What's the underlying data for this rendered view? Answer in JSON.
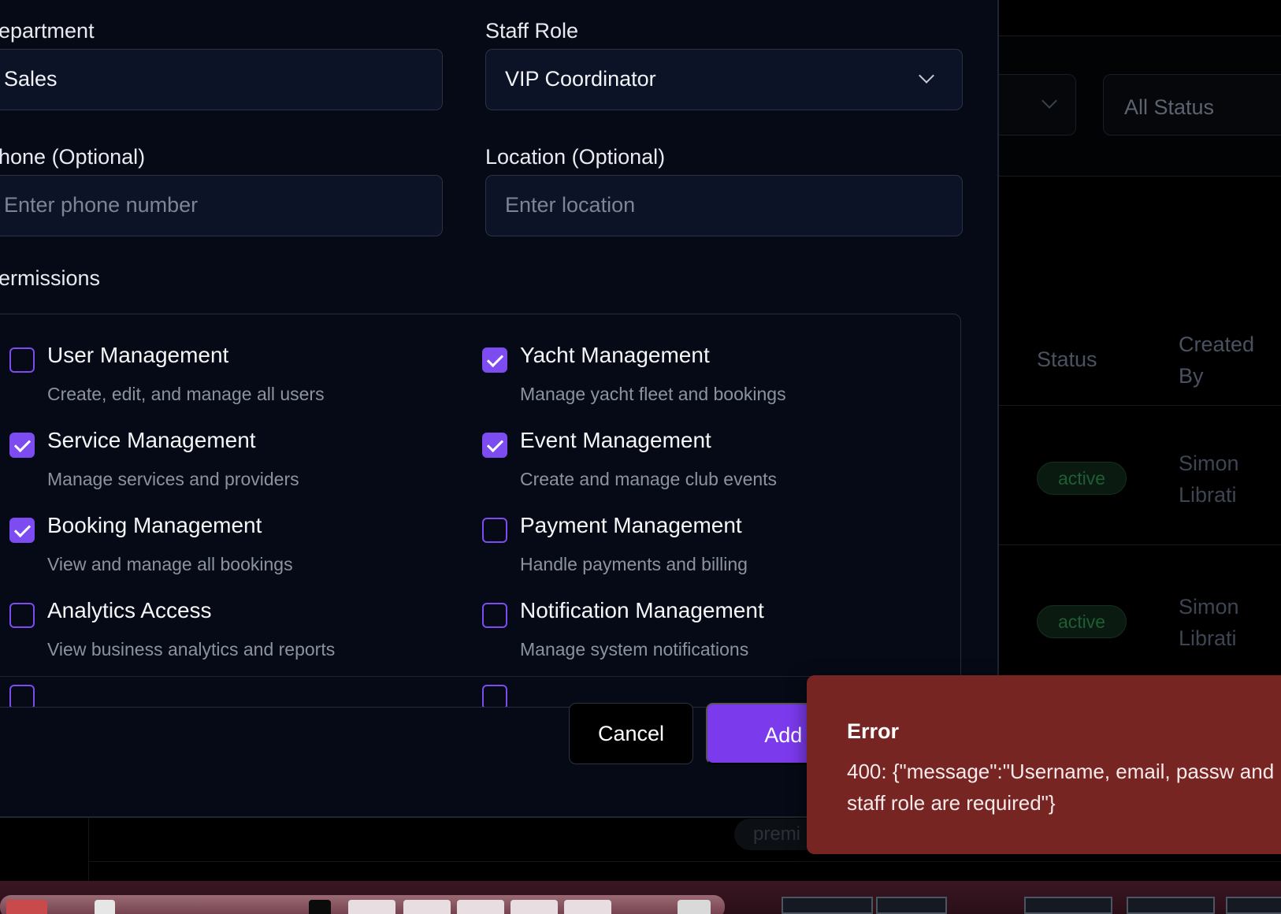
{
  "background": {
    "status_filter": "All Status",
    "table_headers": {
      "status": "Status",
      "created_by": "Created By"
    },
    "rows": [
      {
        "status": "active",
        "created_by": "Simon Librati"
      },
      {
        "status": "active",
        "created_by": "Simon Librati"
      }
    ],
    "partial_badge": "premi"
  },
  "form": {
    "department": {
      "label": "epartment",
      "value": "Sales"
    },
    "staff_role": {
      "label": "Staff Role",
      "value": "VIP Coordinator"
    },
    "phone": {
      "label": "hone (Optional)",
      "placeholder": "Enter phone number"
    },
    "location": {
      "label": "Location (Optional)",
      "placeholder": "Enter location"
    },
    "permissions_heading": "ermissions",
    "permissions": [
      {
        "title": "User Management",
        "desc": "Create, edit, and manage all users",
        "checked": false
      },
      {
        "title": "Yacht Management",
        "desc": "Manage yacht fleet and bookings",
        "checked": true
      },
      {
        "title": "Service Management",
        "desc": "Manage services and providers",
        "checked": true
      },
      {
        "title": "Event Management",
        "desc": "Create and manage club events",
        "checked": true
      },
      {
        "title": "Booking Management",
        "desc": "View and manage all bookings",
        "checked": true
      },
      {
        "title": "Payment Management",
        "desc": "Handle payments and billing",
        "checked": false
      },
      {
        "title": "Analytics Access",
        "desc": "View business analytics and reports",
        "checked": false
      },
      {
        "title": "Notification Management",
        "desc": "Manage system notifications",
        "checked": false
      }
    ],
    "cancel_label": "Cancel",
    "submit_label": "Add S"
  },
  "toast": {
    "title": "Error",
    "message": "400: {\"message\":\"Username, email, passw and staff role are required\"}"
  },
  "colors": {
    "accent": "#7c3aed",
    "error_bg": "#772523",
    "modal_bg": "#050a16"
  }
}
